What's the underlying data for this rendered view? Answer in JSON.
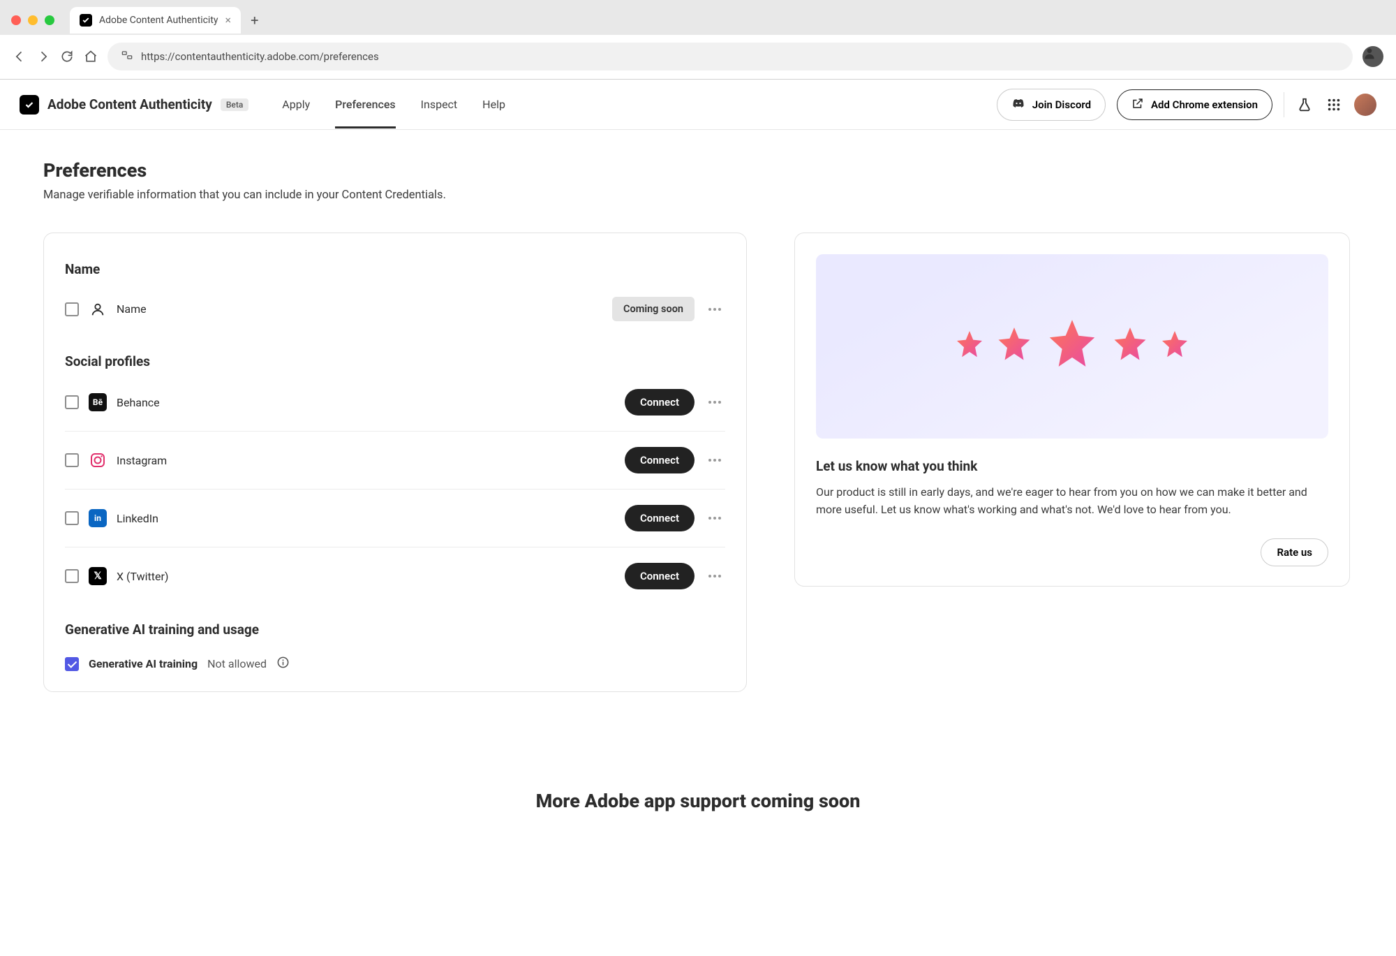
{
  "browser": {
    "tab_title": "Adobe Content Authenticity",
    "url": "https://contentauthenticity.adobe.com/preferences"
  },
  "header": {
    "brand": "Adobe Content Authenticity",
    "badge": "Beta",
    "nav": {
      "apply": "Apply",
      "preferences": "Preferences",
      "inspect": "Inspect",
      "help": "Help"
    },
    "discord": "Join Discord",
    "extension": "Add Chrome extension"
  },
  "page": {
    "title": "Preferences",
    "subtitle": "Manage verifiable information that you can include in your Content Credentials."
  },
  "name_section": {
    "title": "Name",
    "row_label": "Name",
    "badge": "Coming soon"
  },
  "social": {
    "title": "Social profiles",
    "behance": "Behance",
    "instagram": "Instagram",
    "linkedin": "LinkedIn",
    "x": "X (Twitter)",
    "connect": "Connect"
  },
  "ai": {
    "title": "Generative AI training and usage",
    "label": "Generative AI training",
    "status": "Not allowed"
  },
  "feedback": {
    "title": "Let us know what you think",
    "body": "Our product is still in early days, and we're eager to hear from you on how we can make it better and more useful. Let us know what's working and what's not. We'd love to hear from you.",
    "button": "Rate us"
  },
  "footer": {
    "heading": "More Adobe app support coming soon"
  }
}
